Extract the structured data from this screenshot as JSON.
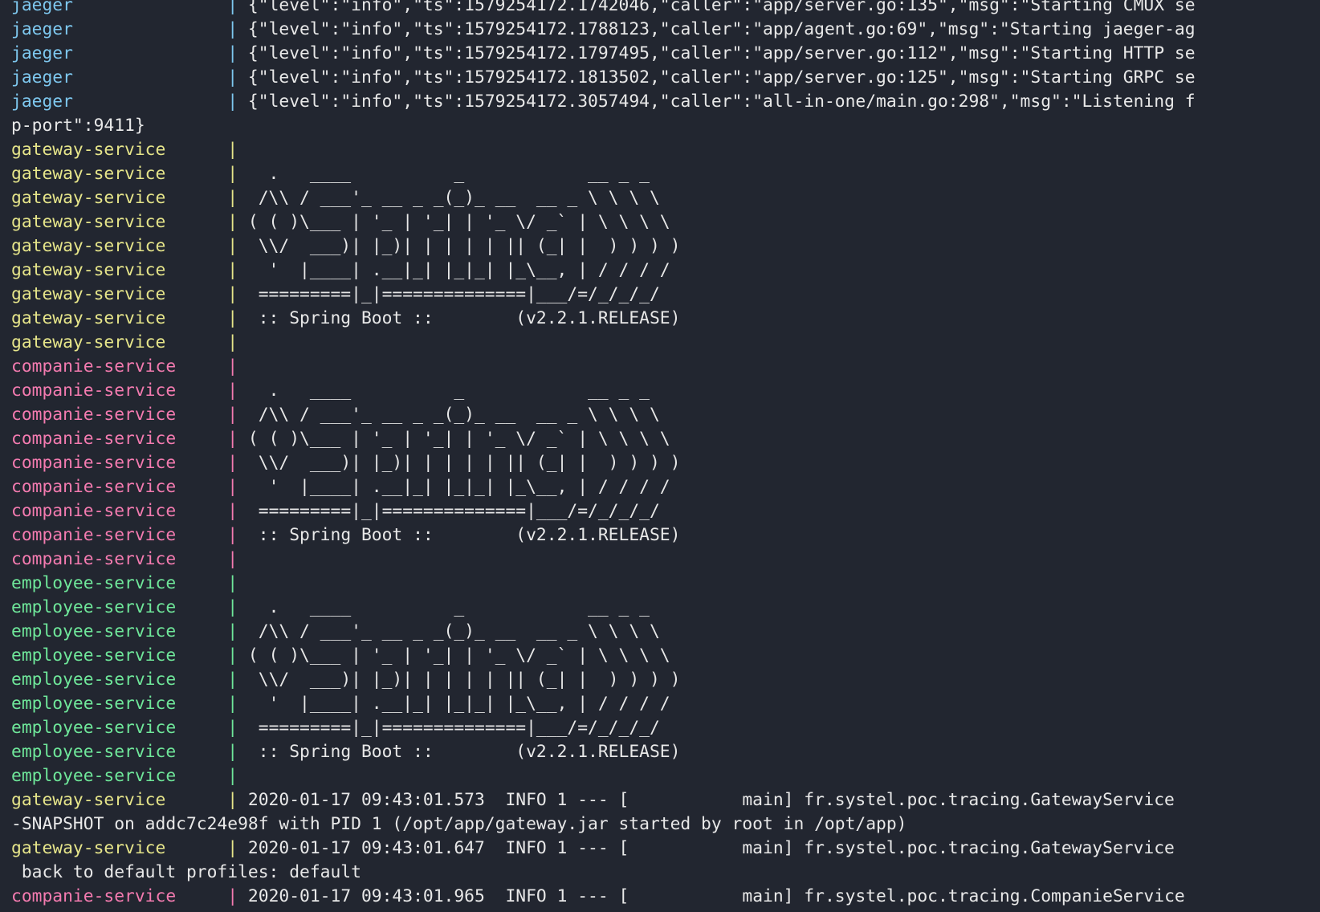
{
  "colors": {
    "background": "#222630",
    "text": "#e8e8e8",
    "jaeger": "#7ec8ef",
    "gateway-service": "#e6e58a",
    "companie-service": "#f47bb0",
    "employee-service": "#6fe79a"
  },
  "lines": [
    {
      "service": "jaeger",
      "sep": " | ",
      "text": "{\"level\":\"info\",\"ts\":1579254172.1742046,\"caller\":\"app/server.go:135\",\"msg\":\"Starting CMUX se"
    },
    {
      "service": "jaeger",
      "sep": " | ",
      "text": "{\"level\":\"info\",\"ts\":1579254172.1788123,\"caller\":\"app/agent.go:69\",\"msg\":\"Starting jaeger-ag"
    },
    {
      "service": "jaeger",
      "sep": " | ",
      "text": "{\"level\":\"info\",\"ts\":1579254172.1797495,\"caller\":\"app/server.go:112\",\"msg\":\"Starting HTTP se"
    },
    {
      "service": "jaeger",
      "sep": " | ",
      "text": "{\"level\":\"info\",\"ts\":1579254172.1813502,\"caller\":\"app/server.go:125\",\"msg\":\"Starting GRPC se"
    },
    {
      "service": "jaeger",
      "sep": " | ",
      "text": "{\"level\":\"info\",\"ts\":1579254172.3057494,\"caller\":\"all-in-one/main.go:298\",\"msg\":\"Listening f"
    },
    {
      "service": "",
      "sep": "",
      "text": "p-port\":9411}"
    },
    {
      "service": "gateway-service",
      "sep": " | ",
      "text": ""
    },
    {
      "service": "gateway-service",
      "sep": " | ",
      "text": "  .   ____          _            __ _ _"
    },
    {
      "service": "gateway-service",
      "sep": " | ",
      "text": " /\\\\ / ___'_ __ _ _(_)_ __  __ _ \\ \\ \\ \\"
    },
    {
      "service": "gateway-service",
      "sep": " | ",
      "text": "( ( )\\___ | '_ | '_| | '_ \\/ _` | \\ \\ \\ \\"
    },
    {
      "service": "gateway-service",
      "sep": " | ",
      "text": " \\\\/  ___)| |_)| | | | | || (_| |  ) ) ) )"
    },
    {
      "service": "gateway-service",
      "sep": " | ",
      "text": "  '  |____| .__|_| |_|_| |_\\__, | / / / /"
    },
    {
      "service": "gateway-service",
      "sep": " | ",
      "text": " =========|_|==============|___/=/_/_/_/"
    },
    {
      "service": "gateway-service",
      "sep": " | ",
      "text": " :: Spring Boot ::        (v2.2.1.RELEASE)"
    },
    {
      "service": "gateway-service",
      "sep": " | ",
      "text": ""
    },
    {
      "service": "companie-service",
      "sep": " | ",
      "text": ""
    },
    {
      "service": "companie-service",
      "sep": " | ",
      "text": "  .   ____          _            __ _ _"
    },
    {
      "service": "companie-service",
      "sep": " | ",
      "text": " /\\\\ / ___'_ __ _ _(_)_ __  __ _ \\ \\ \\ \\"
    },
    {
      "service": "companie-service",
      "sep": " | ",
      "text": "( ( )\\___ | '_ | '_| | '_ \\/ _` | \\ \\ \\ \\"
    },
    {
      "service": "companie-service",
      "sep": " | ",
      "text": " \\\\/  ___)| |_)| | | | | || (_| |  ) ) ) )"
    },
    {
      "service": "companie-service",
      "sep": " | ",
      "text": "  '  |____| .__|_| |_|_| |_\\__, | / / / /"
    },
    {
      "service": "companie-service",
      "sep": " | ",
      "text": " =========|_|==============|___/=/_/_/_/"
    },
    {
      "service": "companie-service",
      "sep": " | ",
      "text": " :: Spring Boot ::        (v2.2.1.RELEASE)"
    },
    {
      "service": "companie-service",
      "sep": " | ",
      "text": ""
    },
    {
      "service": "employee-service",
      "sep": " | ",
      "text": ""
    },
    {
      "service": "employee-service",
      "sep": " | ",
      "text": "  .   ____          _            __ _ _"
    },
    {
      "service": "employee-service",
      "sep": " | ",
      "text": " /\\\\ / ___'_ __ _ _(_)_ __  __ _ \\ \\ \\ \\"
    },
    {
      "service": "employee-service",
      "sep": " | ",
      "text": "( ( )\\___ | '_ | '_| | '_ \\/ _` | \\ \\ \\ \\"
    },
    {
      "service": "employee-service",
      "sep": " | ",
      "text": " \\\\/  ___)| |_)| | | | | || (_| |  ) ) ) )"
    },
    {
      "service": "employee-service",
      "sep": " | ",
      "text": "  '  |____| .__|_| |_|_| |_\\__, | / / / /"
    },
    {
      "service": "employee-service",
      "sep": " | ",
      "text": " =========|_|==============|___/=/_/_/_/"
    },
    {
      "service": "employee-service",
      "sep": " | ",
      "text": " :: Spring Boot ::        (v2.2.1.RELEASE)"
    },
    {
      "service": "employee-service",
      "sep": " | ",
      "text": ""
    },
    {
      "service": "gateway-service",
      "sep": " | ",
      "text": "2020-01-17 09:43:01.573  INFO 1 --- [           main] fr.systel.poc.tracing.GatewayService"
    },
    {
      "service": "",
      "sep": "",
      "text": "-SNAPSHOT on addc7c24e98f with PID 1 (/opt/app/gateway.jar started by root in /opt/app)"
    },
    {
      "service": "gateway-service",
      "sep": " | ",
      "text": "2020-01-17 09:43:01.647  INFO 1 --- [           main] fr.systel.poc.tracing.GatewayService"
    },
    {
      "service": "",
      "sep": "",
      "text": " back to default profiles: default"
    },
    {
      "service": "companie-service",
      "sep": " | ",
      "text": "2020-01-17 09:43:01.965  INFO 1 --- [           main] fr.systel.poc.tracing.CompanieService"
    }
  ]
}
